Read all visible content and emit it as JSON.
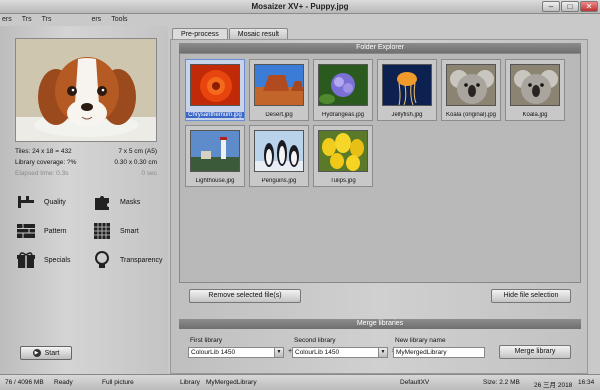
{
  "window": {
    "title": "Mosaizer XV+ - Puppy.jpg",
    "minimize": "–",
    "maximize": "□",
    "close": "✕"
  },
  "menu": [
    "ers",
    "Trs",
    "Trs",
    "ers",
    "Tools"
  ],
  "info": {
    "tiles_label": "Tiles: 24 x 18 = 432",
    "tiles_size": "7 x 5 cm  (A5)",
    "coverage_label": "Library coverage: ?%",
    "coverage_size": "0.30 x 0.30 cm",
    "elapsed_label": "Elapsed time: 0.3s",
    "elapsed_value": "0 sec"
  },
  "tools": {
    "quality": "Quality",
    "masks": "Masks",
    "pattern": "Pattern",
    "smart": "Smart",
    "specials": "Specials",
    "transparency": "Transparency"
  },
  "start_label": "Start",
  "tabs": [
    {
      "label": "Pre-process"
    },
    {
      "label": "Mosaic result"
    }
  ],
  "folder_explorer": {
    "title": "Folder Explorer",
    "files": [
      {
        "label": "Chrysanthemum.jpg",
        "icon": "flower-thumbnail"
      },
      {
        "label": "Desert.jpg",
        "icon": "desert-thumbnail"
      },
      {
        "label": "Hydrangeas.jpg",
        "icon": "hydrangea-thumbnail"
      },
      {
        "label": "Jellyfish.jpg",
        "icon": "jellyfish-thumbnail"
      },
      {
        "label": "Koala (original).jpg",
        "icon": "koala-thumbnail"
      },
      {
        "label": "Koala.jpg",
        "icon": "koala-thumbnail"
      },
      {
        "label": "Lighthouse.jpg",
        "icon": "lighthouse-thumbnail"
      },
      {
        "label": "Penguins.jpg",
        "icon": "penguins-thumbnail"
      },
      {
        "label": "Tulips.jpg",
        "icon": "tulips-thumbnail"
      }
    ],
    "remove_button": "Remove selected file(s)",
    "hide_button": "Hide file selection"
  },
  "merge": {
    "title": "Merge libraries",
    "first_label": "First library",
    "first_value": "ColourLib 1450",
    "second_label": "Second library",
    "second_value": "ColourLib 1450",
    "new_label": "New library name",
    "new_value": "MyMergedLibrary",
    "plus": "+",
    "equals": "=",
    "merge_button": "Merge library"
  },
  "status": {
    "memory": "76 / 4096 MB",
    "state": "Ready",
    "view": "Full picture",
    "library_label": "Library",
    "library_value": "MyMergedLibrary",
    "profile": "DefaultXV",
    "size": "Size: 2.2 MB",
    "date": "26 三月 2018",
    "time": "16:34"
  },
  "colors": {
    "selection": "#3b67c7",
    "panel": "#c9c9c9",
    "header": "#7a7a7a"
  }
}
